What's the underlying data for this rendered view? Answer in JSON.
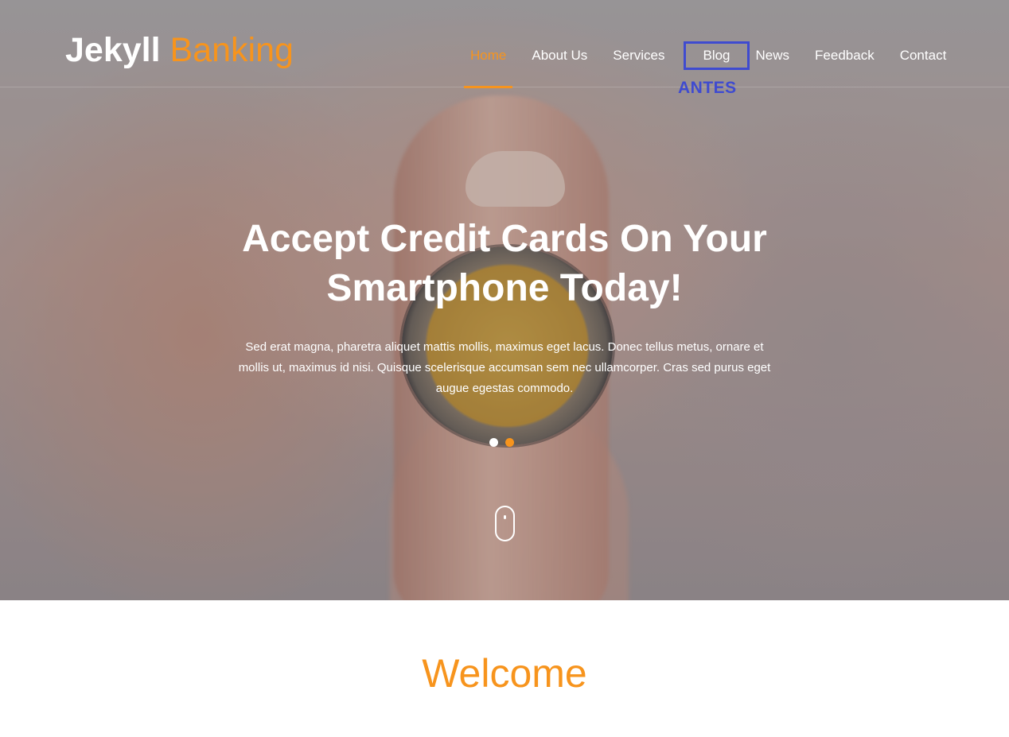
{
  "brand": {
    "name_bold": "Jekyll",
    "name_accent": "Banking"
  },
  "nav": {
    "items": [
      {
        "label": "Home",
        "active": true
      },
      {
        "label": "About Us"
      },
      {
        "label": "Services"
      },
      {
        "label": "Blog",
        "highlighted": true
      },
      {
        "label": "News"
      },
      {
        "label": "Feedback"
      },
      {
        "label": "Contact"
      }
    ],
    "annotation": "ANTES"
  },
  "hero": {
    "title": "Accept Credit Cards On Your Smartphone Today!",
    "text": "Sed erat magna, pharetra aliquet mattis mollis, maximus eget lacus. Donec tellus metus, ornare et mollis ut, maximus id nisi. Quisque scelerisque accumsan sem nec ullamcorper. Cras sed purus eget augue egestas commodo.",
    "slides": 2,
    "active_slide": 2,
    "scroll_icon": "mouse-scroll-icon"
  },
  "welcome": {
    "title": "Welcome"
  },
  "colors": {
    "accent": "#f7941d",
    "annotation": "#3f4bd0",
    "text_light": "#ffffff"
  }
}
